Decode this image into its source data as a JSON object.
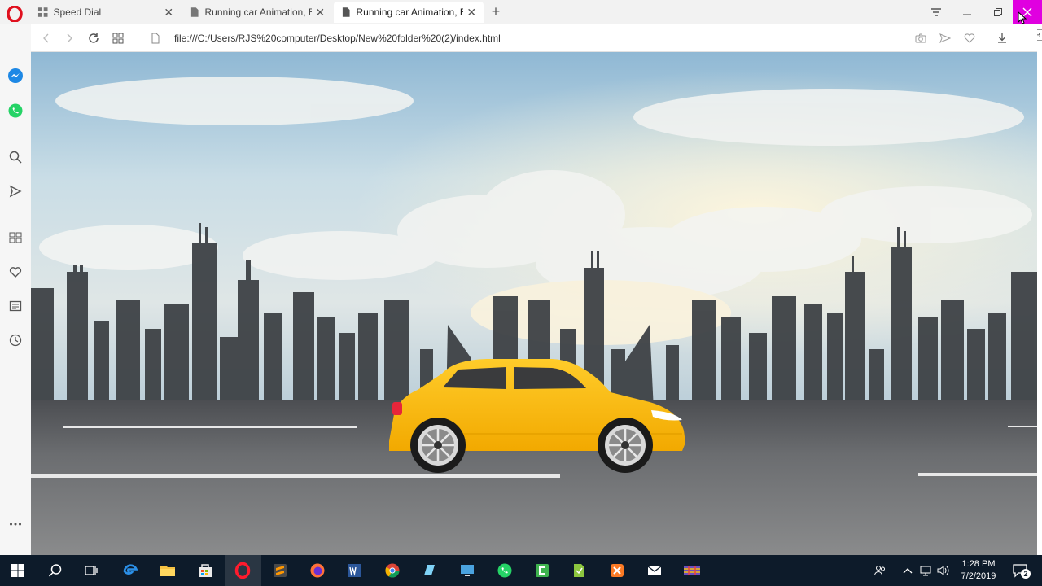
{
  "tabs": [
    {
      "title": "Speed Dial",
      "active": false
    },
    {
      "title": "Running car Animation, Ea",
      "active": false
    },
    {
      "title": "Running car Animation, Ea",
      "active": true
    }
  ],
  "address": {
    "url": "file:///C:/Users/RJS%20computer/Desktop/New%20folder%20(2)/index.html"
  },
  "window": {
    "close_tooltip": "Close"
  },
  "sidebar": {
    "items": [
      "messenger-icon",
      "whatsapp-icon",
      "search-icon",
      "send-icon",
      "grid-icon",
      "heart-icon",
      "news-icon",
      "history-icon",
      "more-icon"
    ]
  },
  "taskbar": {
    "time": "1:28 PM",
    "date": "7/2/2019",
    "notification_count": "2"
  },
  "colors": {
    "car": "#ffc21a",
    "road": "#5a5c5f",
    "skyline": "#3e4246",
    "opera_red": "#e0101e"
  }
}
